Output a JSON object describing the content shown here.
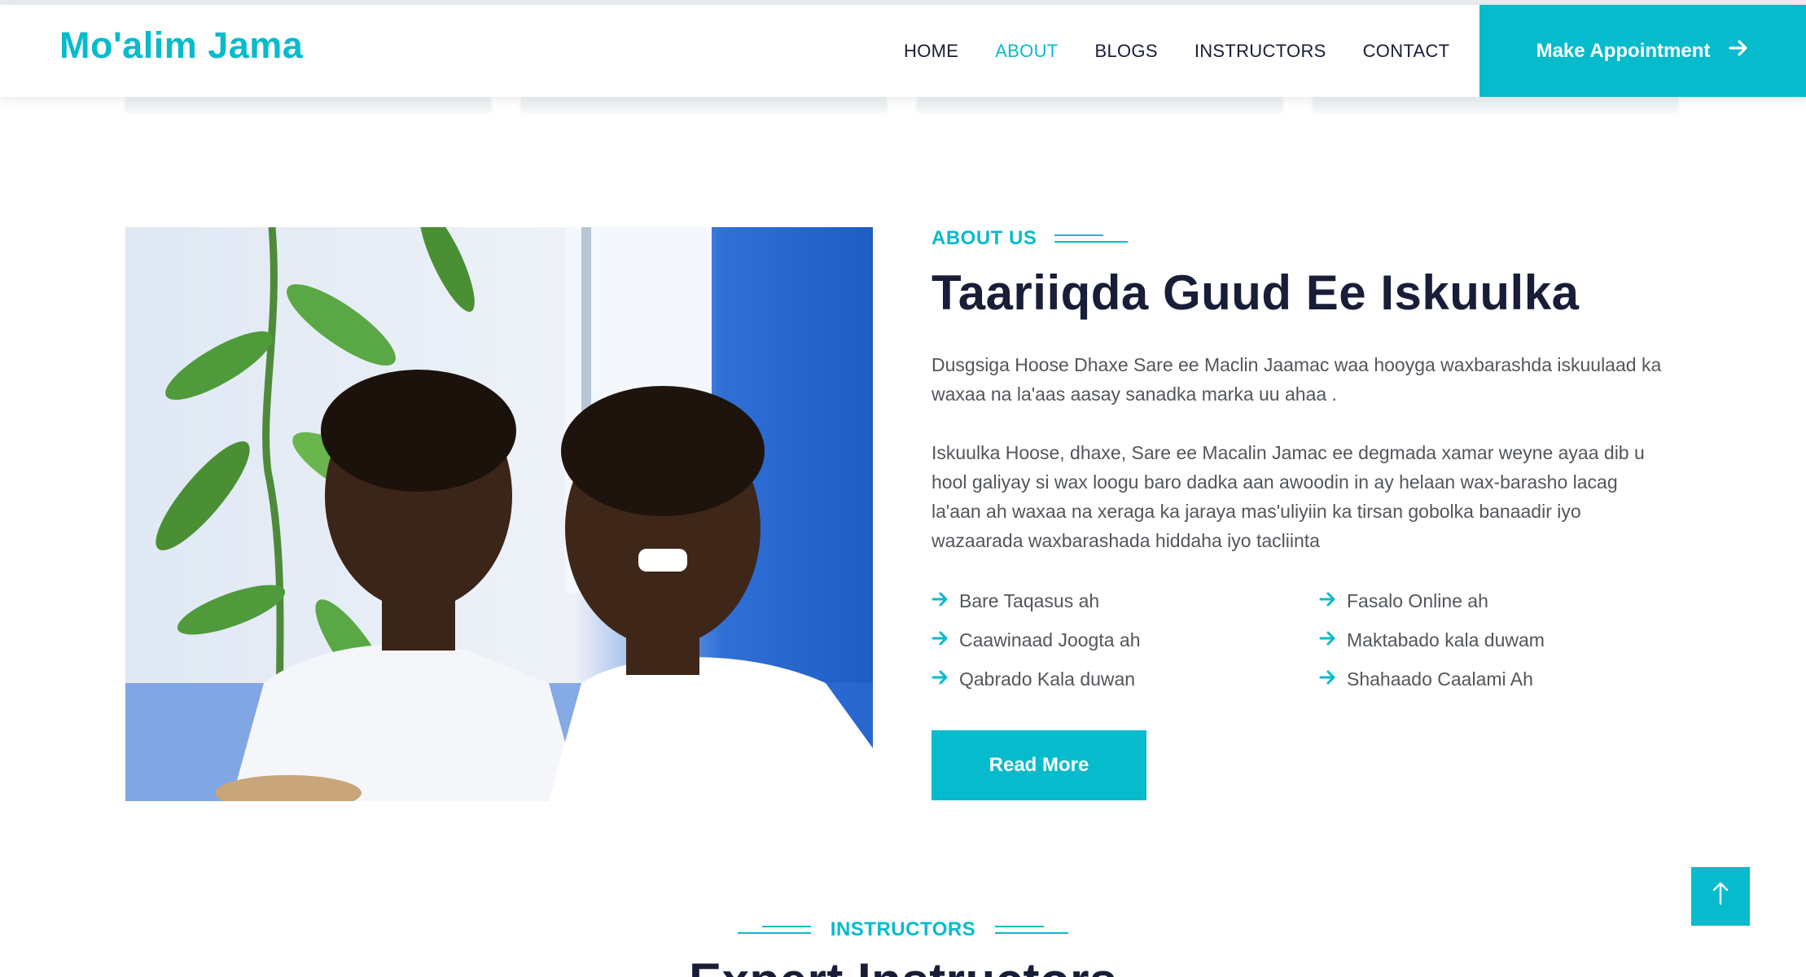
{
  "header": {
    "brand": "Mo'alim Jama",
    "nav": [
      {
        "label": "HOME",
        "active": false
      },
      {
        "label": "ABOUT",
        "active": true
      },
      {
        "label": "BLOGS",
        "active": false
      },
      {
        "label": "INSTRUCTORS",
        "active": false
      },
      {
        "label": "CONTACT",
        "active": false
      }
    ],
    "cta_label": "Make Appointment",
    "cta_icon": "arrow-right-icon"
  },
  "about": {
    "tag": "ABOUT US",
    "title": "Taariiqda Guud Ee Iskuulka",
    "paragraph_1": "Dusgsiga Hoose Dhaxe Sare ee Maclin Jaamac waa hooyga waxbarashda iskuulaad ka waxaa na la'aas aasay sanadka marka uu ahaa .",
    "paragraph_2": "Iskuulka Hoose, dhaxe, Sare ee Macalin Jamac ee degmada xamar weyne ayaa dib u hool galiyay si wax loogu baro dadka aan awoodin in ay helaan wax-barasho lacag la'aan ah waxaa na xeraga ka jaraya mas'uliyiin ka tirsan gobolka banaadir iyo wazaarada waxbarashada hiddaha iyo tacliinta",
    "features": [
      "Bare Taqasus ah",
      "Fasalo Online ah",
      "Caawinaad Joogta ah",
      "Maktabado kala duwam",
      "Qabrado Kala duwan",
      "Shahaado Caalami Ah"
    ],
    "feature_icon": "arrow-right-icon",
    "read_more": "Read More",
    "image_subject": "two-students-with-plant"
  },
  "instructors": {
    "tag": "INSTRUCTORS",
    "title": "Expert Instructors"
  },
  "back_to_top_icon": "arrow-up-icon",
  "colors": {
    "accent": "#06bbcc",
    "heading": "#181d38",
    "body_text": "#52565b"
  }
}
